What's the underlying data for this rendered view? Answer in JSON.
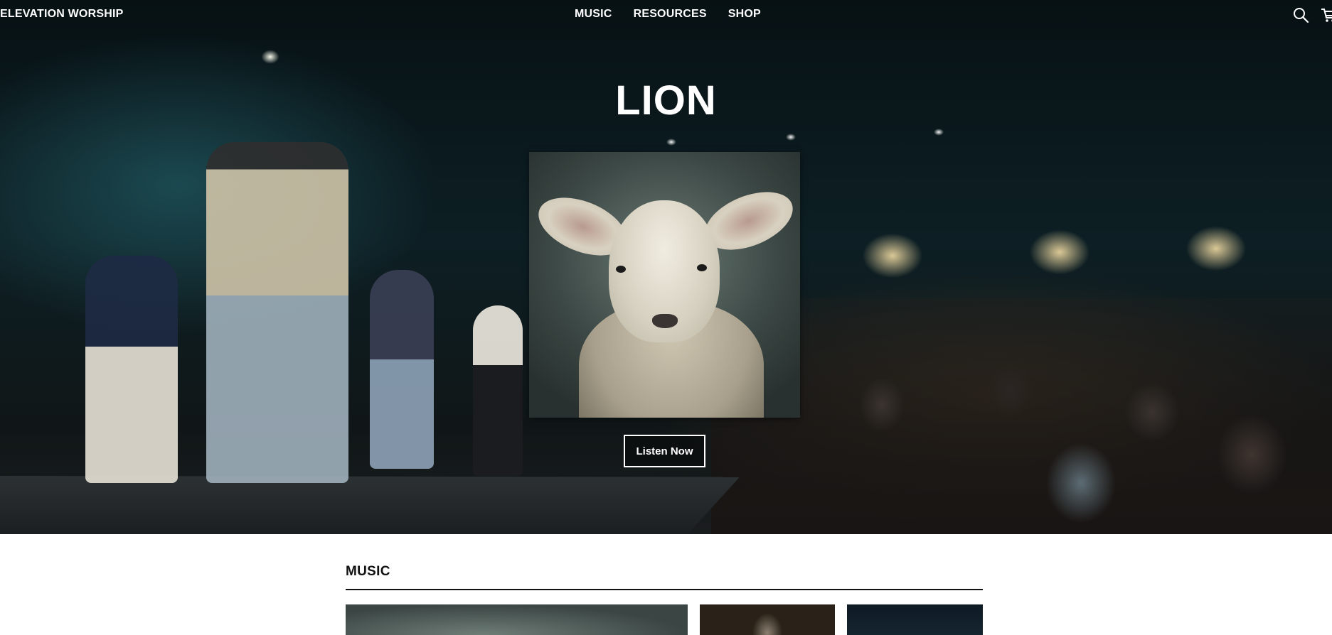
{
  "nav": {
    "brand": "ELEVATION WORSHIP",
    "links": [
      {
        "label": "MUSIC"
      },
      {
        "label": "RESOURCES"
      },
      {
        "label": "SHOP"
      }
    ],
    "icons": [
      "search-icon",
      "cart-icon"
    ]
  },
  "hero": {
    "title": "LION",
    "cta_label": "Listen Now"
  },
  "music_section": {
    "title": "MUSIC"
  },
  "colors": {
    "nav_text": "#ffffff",
    "section_text": "#111111",
    "page_background": "#ffffff"
  }
}
